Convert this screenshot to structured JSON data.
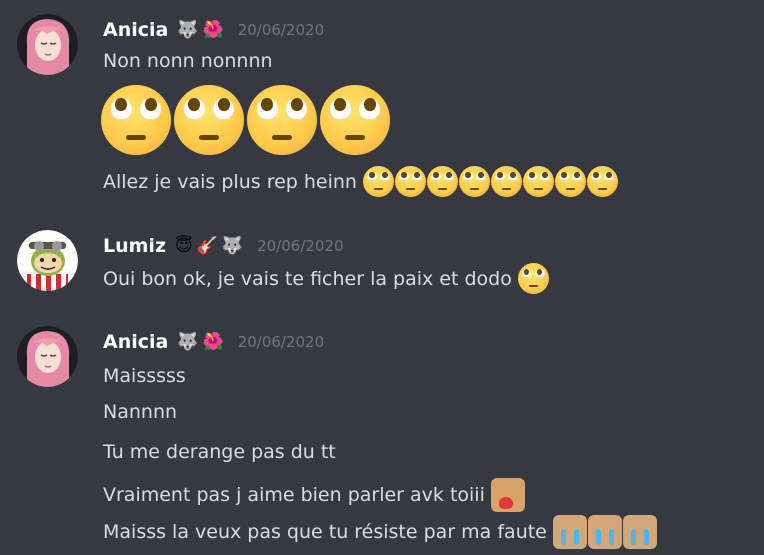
{
  "messages": [
    {
      "author": "Anicia",
      "badges": [
        "🐺",
        "🌺"
      ],
      "timestamp": "20/06/2020",
      "lines": [
        "Non nonn nonnnn",
        "Allez je vais plus rep heinn"
      ],
      "big_emoji_count": 4,
      "inline_emoji_count": 8
    },
    {
      "author": "Lumiz",
      "badges": [
        "😇",
        "🎸",
        "🐺"
      ],
      "timestamp": "20/06/2020",
      "lines": [
        "Oui bon ok, je vais te ficher la paix et dodo"
      ]
    },
    {
      "author": "Anicia",
      "badges": [
        "🐺",
        "🌺"
      ],
      "timestamp": "20/06/2020",
      "lines": [
        "Maisssss",
        "Nannnn",
        "Tu me derange pas du tt",
        "Vraiment pas j aime bien parler avk toiii",
        "Maisss la veux pas que tu résiste par ma faute"
      ]
    }
  ],
  "emoji_names": {
    "rolling_eyes": "face-with-rolling-eyes-icon",
    "cat_heart": "cat-holding-heart-emoji",
    "crying": "crying-emoji"
  },
  "colors": {
    "background": "#36393f",
    "author": "#ffffff",
    "text": "#dcddde",
    "timestamp": "#72767d"
  }
}
